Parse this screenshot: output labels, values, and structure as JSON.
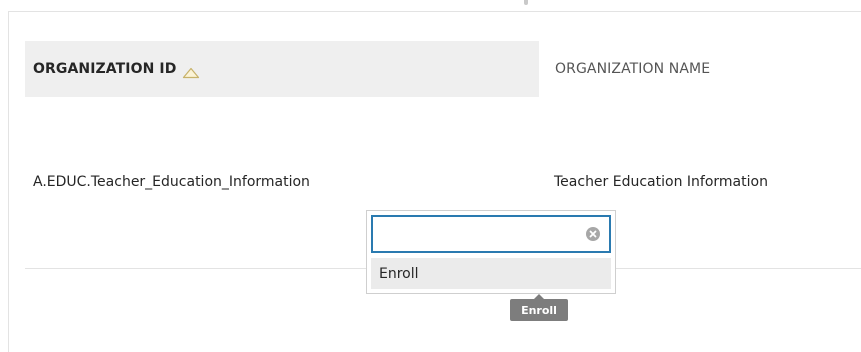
{
  "table": {
    "headers": {
      "organization_id": "ORGANIZATION ID",
      "organization_name": "ORGANIZATION NAME",
      "sort_icon": "triangle-up-outline-icon"
    },
    "rows": [
      {
        "organization_id": "A.EDUC.Teacher_Education_Information",
        "organization_name": "Teacher Education Information"
      }
    ]
  },
  "dropdown": {
    "input_value": "",
    "input_placeholder": "",
    "clear_icon": "circle-x-icon",
    "options": [
      {
        "label": "Enroll"
      }
    ]
  },
  "tooltip": {
    "label": "Enroll"
  },
  "colors": {
    "header_highlight": "#efefef",
    "focus_border": "#2a7ab0",
    "tooltip_bg": "#7d7d7d",
    "option_hover": "#ebebeb"
  }
}
